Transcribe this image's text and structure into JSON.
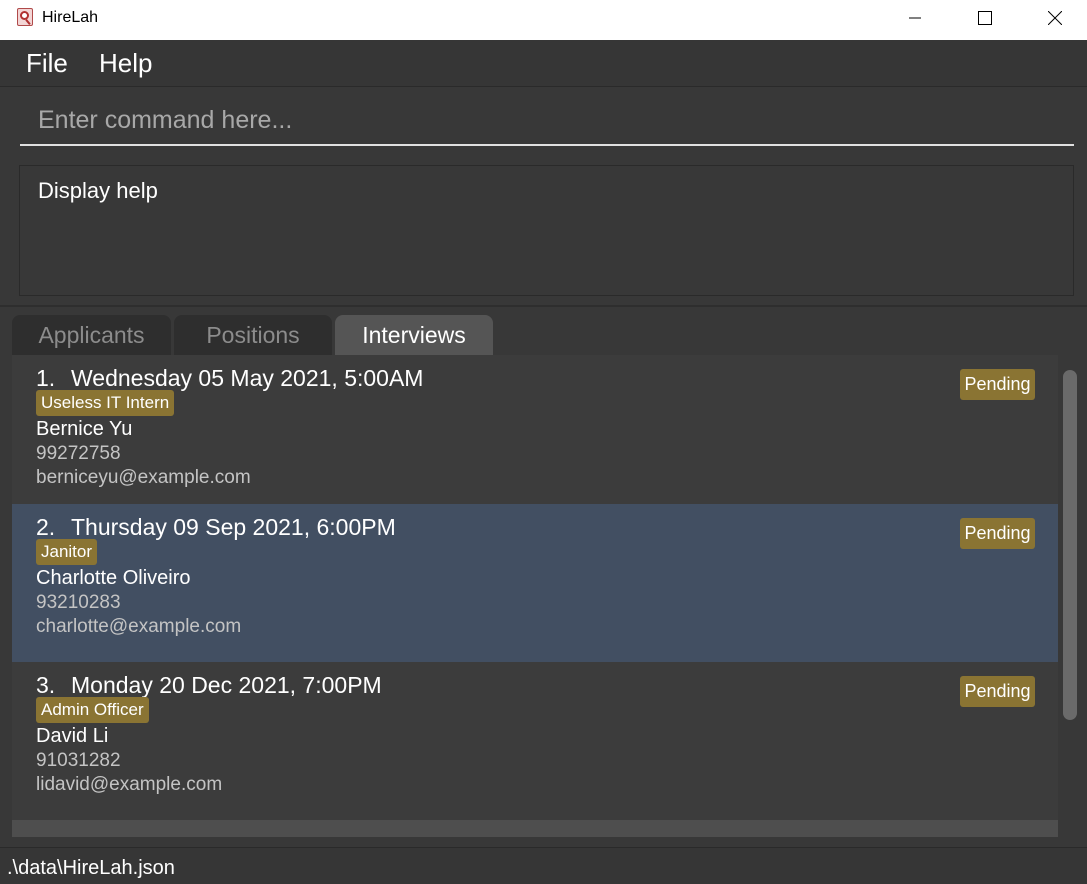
{
  "window": {
    "title": "HireLah"
  },
  "menu": {
    "file": "File",
    "help": "Help"
  },
  "command": {
    "placeholder": "Enter command here...",
    "value": ""
  },
  "result": {
    "text": "Display help"
  },
  "tabs": [
    {
      "label": "Applicants",
      "selected": false
    },
    {
      "label": "Positions",
      "selected": false
    },
    {
      "label": "Interviews",
      "selected": true
    }
  ],
  "interviews": [
    {
      "index": "1.",
      "datetime": "Wednesday 05 May 2021, 5:00AM",
      "position": "Useless IT Intern",
      "name": "Bernice Yu",
      "phone": "99272758",
      "email": "berniceyu@example.com",
      "status": "Pending"
    },
    {
      "index": "2.",
      "datetime": "Thursday 09 Sep 2021, 6:00PM",
      "position": "Janitor",
      "name": "Charlotte Oliveiro",
      "phone": "93210283",
      "email": "charlotte@example.com",
      "status": "Pending",
      "selected": true
    },
    {
      "index": "3.",
      "datetime": "Monday 20 Dec 2021, 7:00PM",
      "position": "Admin Officer",
      "name": "David Li",
      "phone": "91031282",
      "email": "lidavid@example.com",
      "status": "Pending"
    }
  ],
  "status_bar": {
    "path": ".\\data\\HireLah.json"
  },
  "colors": {
    "tag": "#8a7433",
    "selected_row": "#424f62",
    "background": "#383838"
  }
}
